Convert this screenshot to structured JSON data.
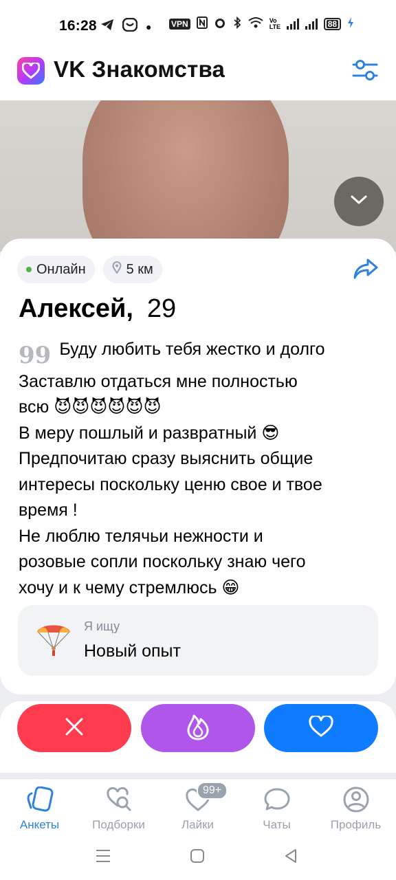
{
  "status_bar": {
    "time": "16:28",
    "vpn_label": "VPN",
    "volte_label": "Vo LTE",
    "battery_level": "88"
  },
  "header": {
    "title": "VK Знакомства",
    "logo_icon": "heart-icon",
    "filter_icon": "sliders-icon"
  },
  "profile": {
    "status_online": "Онлайн",
    "distance": "5 км",
    "name": "Алексей,",
    "age": "29",
    "quote_mark": "99",
    "bio": "Буду любить тебя жестко и долго\nЗаставлю отдаться мне полностью\nвсю 😈😈😈😈😈😈\nВ меру пошлый и развратный 😎\nПредпочитаю сразу выяснить общие\nинтересы поскольку ценю свое и твое\nвремя !\nНе люблю телячьи нежности и\nрозовые сопли поскольку знаю чего\nхочу и к чему стремлюсь 😁",
    "looking_for_label": "Я ищу",
    "looking_for_value": "Новый опыт"
  },
  "actions": {
    "dislike_icon": "close-icon",
    "superlike_icon": "fire-icon",
    "like_icon": "heart-icon"
  },
  "tabs": [
    {
      "label": "Анкеты",
      "icon": "cards-icon",
      "active": true
    },
    {
      "label": "Подборки",
      "icon": "heart-search-icon",
      "active": false
    },
    {
      "label": "Лайки",
      "icon": "likes-icon",
      "badge": "99+",
      "active": false
    },
    {
      "label": "Чаты",
      "icon": "chat-icon",
      "active": false
    },
    {
      "label": "Профиль",
      "icon": "profile-icon",
      "active": false
    }
  ],
  "colors": {
    "accent": "#2d81e0",
    "dislike": "#ff3b4f",
    "superlike": "#b056ea",
    "like": "#0f7bff",
    "online": "#4bb34b"
  }
}
